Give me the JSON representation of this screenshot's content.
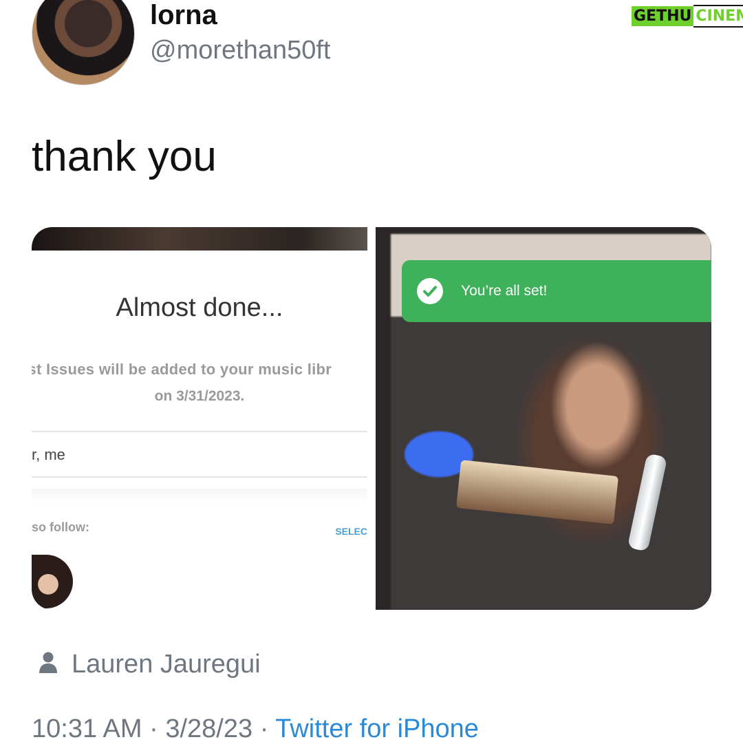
{
  "tweet": {
    "display_name": "lorna",
    "handle": "@morethan50ft",
    "text": "thank you",
    "media_author": "Lauren Jauregui",
    "time": "10:31 AM",
    "date": "3/28/23",
    "separator": "·",
    "source": "Twitter for iPhone"
  },
  "watermark": {
    "part1": "GETHU",
    "part2": "CINEMA"
  },
  "left_screen": {
    "title": "Almost done...",
    "desc_line1": "ıst Issues will be added to your music libr",
    "desc_line2": "on 3/31/2023.",
    "artist_line": "r, me",
    "also_follow": "so follow:",
    "select_link": "SELEC"
  },
  "right_screen": {
    "banner_text": "You’re all set!"
  },
  "colors": {
    "banner_green": "#3fb15a",
    "meta_gray": "#6e7780",
    "link_blue": "#2a8ad6",
    "select_blue": "#4a9fd6"
  },
  "icons": {
    "check": "check-circle-icon",
    "person": "person-icon"
  }
}
